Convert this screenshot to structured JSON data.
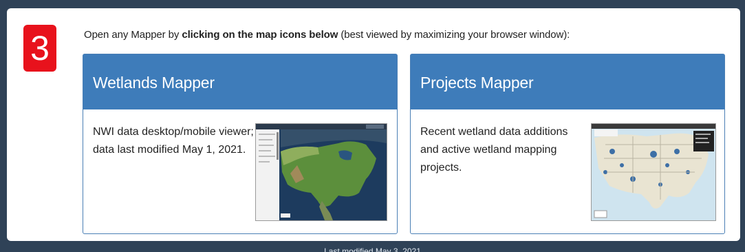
{
  "step": {
    "number": "3"
  },
  "instructions": {
    "prefix": "Open any Mapper by ",
    "bold": "clicking on the map icons below",
    "suffix": " (best viewed by maximizing your browser window):"
  },
  "cards": [
    {
      "title": "Wetlands Mapper",
      "description": "NWI data desktop/mobile viewer; data last modified May 1, 2021.",
      "thumbnail_icon": "wetlands-map-icon"
    },
    {
      "title": "Projects Mapper",
      "description": "Recent wetland data additions and active wetland mapping projects.",
      "thumbnail_icon": "projects-map-icon"
    }
  ],
  "footer": {
    "text": "Last modified May 3, 2021"
  },
  "colors": {
    "badge": "#e8121c",
    "card_header": "#3e7cba",
    "background": "#2f4257"
  }
}
